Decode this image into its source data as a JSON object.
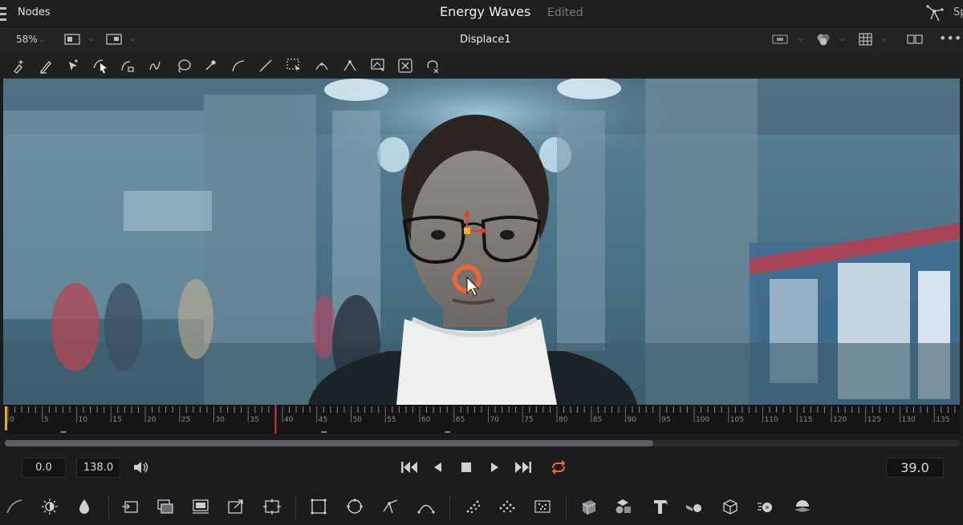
{
  "titlebar": {
    "left_label": "Nodes",
    "project_name": "Energy Waves",
    "status": "Edited",
    "right_label": "Sp"
  },
  "viewer_header": {
    "zoom": "58%",
    "node_name": "Displace1"
  },
  "timeline": {
    "tick_labels": [
      "0",
      "5",
      "10",
      "15",
      "20",
      "25",
      "30",
      "35",
      "40",
      "45",
      "50",
      "55",
      "60",
      "65",
      "70",
      "75",
      "80",
      "85",
      "90",
      "95",
      "100",
      "105",
      "110",
      "115",
      "120",
      "125",
      "130",
      "135"
    ],
    "playhead_frame": 39
  },
  "transport": {
    "start": "0.0",
    "end": "138.0",
    "current": "39.0"
  },
  "colors": {
    "accent_orange": "#e8663a",
    "playhead": "#d8343b"
  },
  "icons": {
    "tools": [
      "add-point-icon",
      "draw-icon",
      "insert-point-icon",
      "select-icon",
      "modify-icon",
      "polyline-icon",
      "lasso-icon",
      "point-icon",
      "bezier-icon",
      "line-icon",
      "marquee-icon",
      "smooth-icon",
      "corner-icon",
      "reshape-icon",
      "delete-icon",
      "close-shape-icon"
    ],
    "bottom": [
      "curve-icon",
      "brightness-icon",
      "blur-icon",
      "loader-icon",
      "merge-icon",
      "background-icon",
      "transform-icon",
      "resize-icon",
      "rectangle-icon",
      "ellipse-icon",
      "polygon-icon",
      "bspline-icon",
      "particle-emitter-icon",
      "particle-render-icon",
      "particle-scatter-icon",
      "shape3d-icon",
      "merge3d-icon",
      "text3d-icon",
      "camera3d-icon",
      "renderer3d-icon",
      "light3d-icon",
      "image-plane-icon"
    ]
  }
}
